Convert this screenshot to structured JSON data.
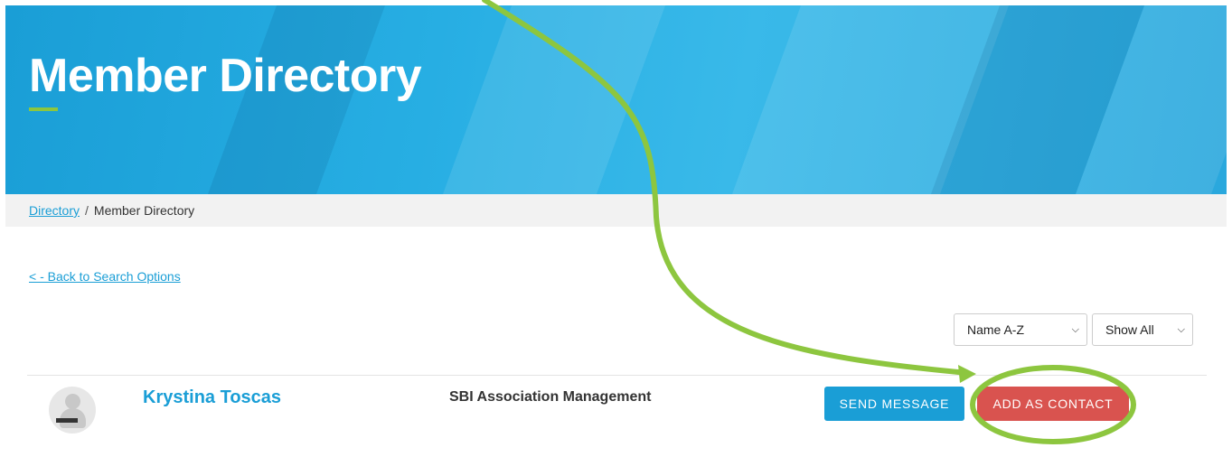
{
  "hero": {
    "title": "Member Directory"
  },
  "breadcrumb": {
    "root": "Directory",
    "separator": "/",
    "current": "Member Directory"
  },
  "back_link": "< - Back to Search Options",
  "filters": {
    "sort": {
      "selected": "Name A-Z"
    },
    "show": {
      "selected": "Show All"
    }
  },
  "member": {
    "name": "Krystina Toscas",
    "organization": "SBI Association Management",
    "send_label": "SEND MESSAGE",
    "add_label": "ADD AS CONTACT"
  },
  "colors": {
    "accent_blue": "#1a9ed6",
    "accent_red": "#d9534f",
    "annotation_green": "#8dc63f"
  },
  "icons": {
    "dropdown": "chevron-down-icon",
    "avatar": "user-placeholder-icon"
  }
}
